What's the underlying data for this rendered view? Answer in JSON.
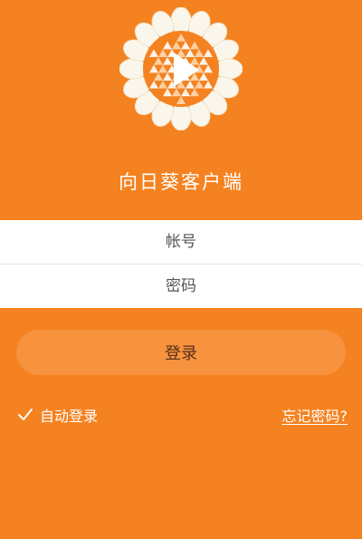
{
  "app": {
    "title": "向日葵客户端"
  },
  "form": {
    "account_placeholder": "帐号",
    "password_placeholder": "密码",
    "login_label": "登录"
  },
  "options": {
    "auto_login_label": "自动登录",
    "auto_login_checked": true,
    "forgot_password_label": "忘记密码?"
  },
  "colors": {
    "brand_orange": "#f58220",
    "button_orange": "#f7923f",
    "field_bg": "#ffffff"
  },
  "icons": {
    "logo": "sunflower-logo",
    "check": "check-icon"
  }
}
